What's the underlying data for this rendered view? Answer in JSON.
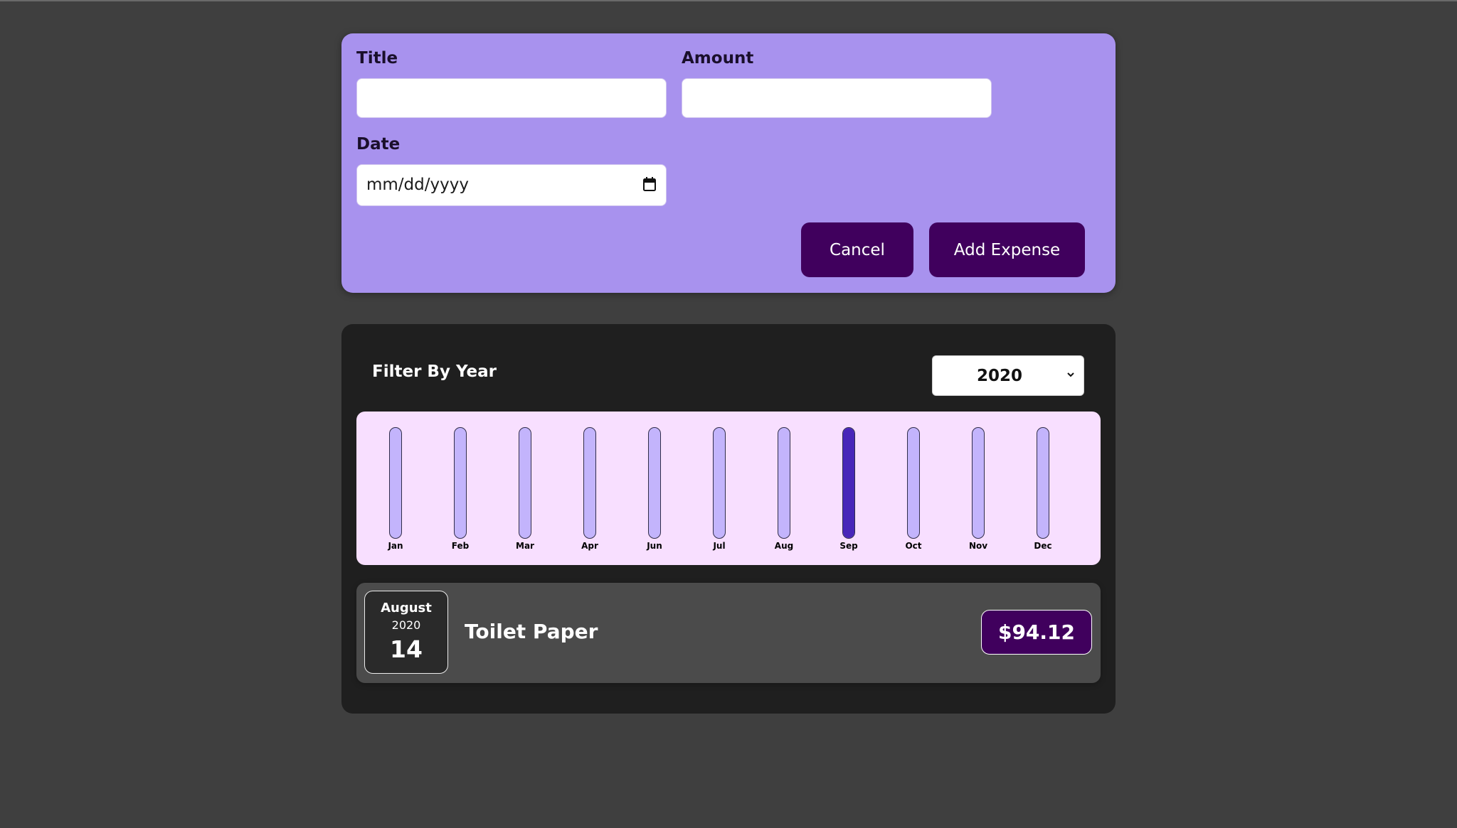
{
  "form": {
    "title_label": "Title",
    "title_value": "",
    "amount_label": "Amount",
    "amount_value": "",
    "date_label": "Date",
    "date_placeholder": "mm/dd/yyyy",
    "cancel_label": "Cancel",
    "submit_label": "Add Expense",
    "colors": {
      "panel": "#a892ee",
      "button": "#40005d"
    }
  },
  "filter": {
    "label": "Filter By Year",
    "selected_year": "2020"
  },
  "chart_data": {
    "type": "bar",
    "categories": [
      "Jan",
      "Feb",
      "Mar",
      "Apr",
      "Jun",
      "Jul",
      "Aug",
      "Sep",
      "Oct",
      "Nov",
      "Dec"
    ],
    "values": [
      0,
      0,
      0,
      0,
      0,
      0,
      0,
      1,
      0,
      0,
      0
    ],
    "ylim": [
      0,
      1
    ],
    "colors": {
      "fill": "#4826b9",
      "empty": "#c3b4fc",
      "background": "#f8dfff"
    }
  },
  "expenses": [
    {
      "month": "August",
      "year": "2020",
      "day": "14",
      "title": "Toilet Paper",
      "amount": "$94.12"
    }
  ]
}
